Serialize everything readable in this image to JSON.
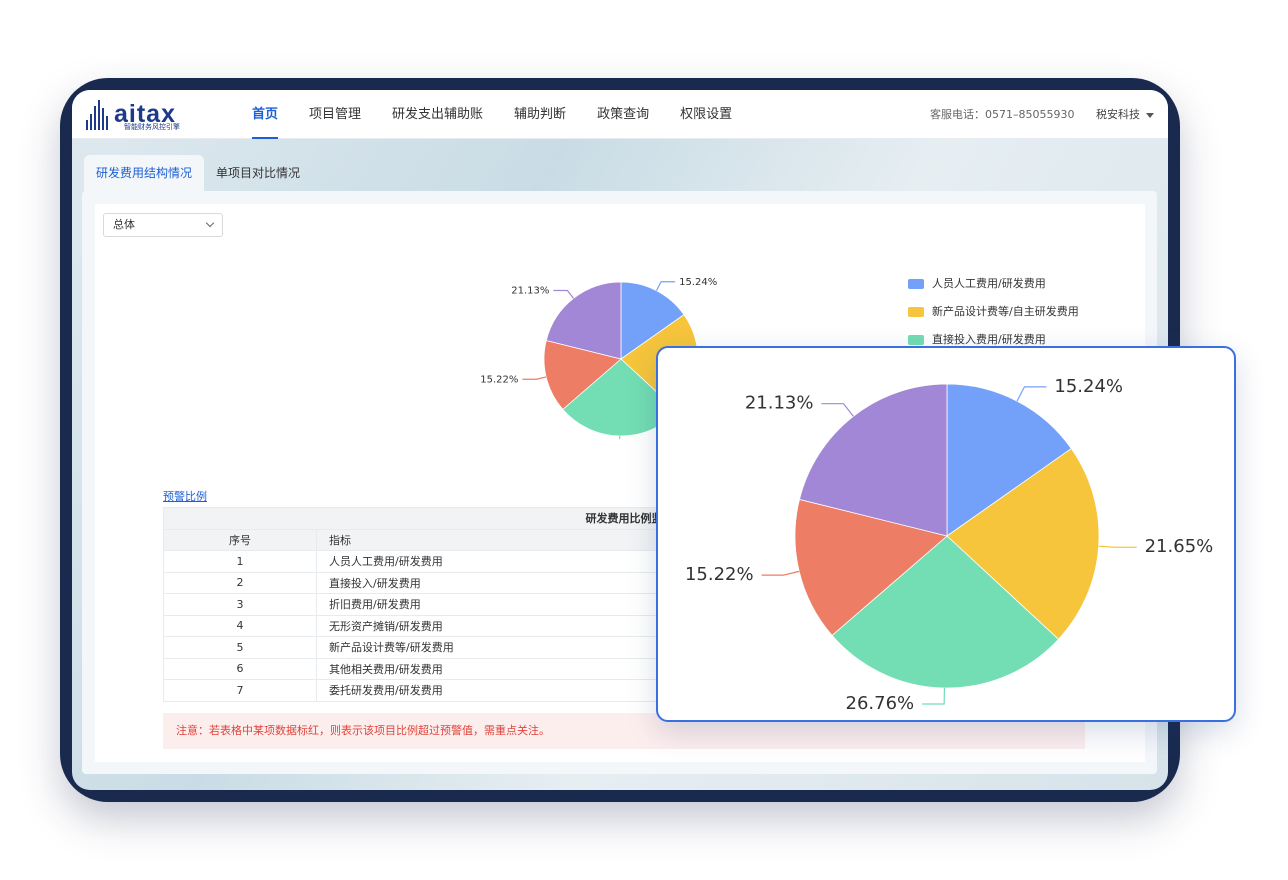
{
  "brand": {
    "name": "aitax",
    "tagline": "智能财务风控引擎"
  },
  "nav": {
    "items": [
      {
        "label": "首页",
        "active": true
      },
      {
        "label": "项目管理"
      },
      {
        "label": "研发支出辅助账"
      },
      {
        "label": "辅助判断"
      },
      {
        "label": "政策查询"
      },
      {
        "label": "权限设置"
      }
    ],
    "hotline": "客服电话：0571–85055930",
    "company": "税安科技"
  },
  "tabs": [
    {
      "label": "研发费用结构情况",
      "active": true
    },
    {
      "label": "单项目对比情况"
    }
  ],
  "filter": {
    "selected": "总体"
  },
  "chart_data": {
    "type": "pie",
    "slices": [
      {
        "name": "人员人工费用/研发费用",
        "value": 15.24,
        "label": "15.24%",
        "color": "#73a1fa"
      },
      {
        "name": "新产品设计费等/自主研发费用",
        "value": 21.65,
        "label": "21.65%",
        "color": "#f6c53b"
      },
      {
        "name": "直接投入费用/研发费用",
        "value": 26.76,
        "label": "26.76%",
        "color": "#73ddb3"
      },
      {
        "name": "",
        "value": 15.22,
        "label": "15.22%",
        "color": "#ed7d64"
      },
      {
        "name": "",
        "value": 21.13,
        "label": "21.13%",
        "color": "#a287d6"
      }
    ],
    "legend_entries": [
      {
        "name": "人员人工费用/研发费用",
        "color": "#73a1fa"
      },
      {
        "name": "新产品设计费等/自主研发费用",
        "color": "#f6c53b"
      },
      {
        "name": "直接投入费用/研发费用",
        "color": "#73ddb3"
      }
    ],
    "legend_position": "right"
  },
  "warning_link": "预警比例",
  "table": {
    "caption": "研发费用比例监",
    "headers": [
      "序号",
      "指标"
    ],
    "rows": [
      [
        "1",
        "人员人工费用/研发费用"
      ],
      [
        "2",
        "直接投入/研发费用"
      ],
      [
        "3",
        "折旧费用/研发费用"
      ],
      [
        "4",
        "无形资产摊销/研发费用"
      ],
      [
        "5",
        "新产品设计费等/研发费用"
      ],
      [
        "6",
        "其他相关费用/研发费用"
      ],
      [
        "7",
        "委托研发费用/研发费用"
      ]
    ]
  },
  "note": "注意：若表格中某项数据标红，则表示该项目比例超过预警值，需重点关注。"
}
